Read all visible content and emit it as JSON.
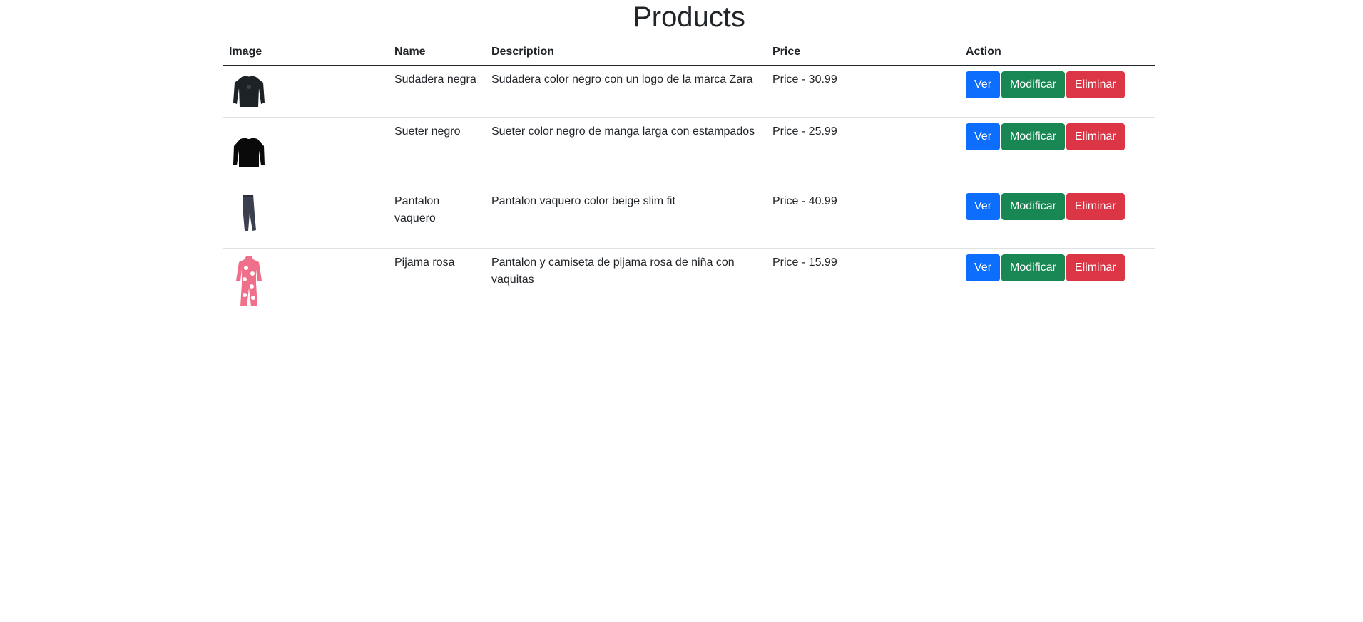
{
  "page": {
    "title": "Products"
  },
  "table": {
    "headers": {
      "image": "Image",
      "name": "Name",
      "description": "Description",
      "price": "Price",
      "action": "Action"
    },
    "rows": [
      {
        "name": "Sudadera negra",
        "description": "Sudadera color negro con un logo de la marca Zara",
        "price": "Price - 30.99",
        "image_icon": "black-sweatshirt-image",
        "actions": {
          "view": "Ver",
          "edit": "Modificar",
          "delete": "Eliminar"
        }
      },
      {
        "name": "Sueter negro",
        "description": "Sueter color negro de manga larga con estampados",
        "price": "Price - 25.99",
        "image_icon": "black-sweater-image",
        "actions": {
          "view": "Ver",
          "edit": "Modificar",
          "delete": "Eliminar"
        }
      },
      {
        "name": "Pantalon vaquero",
        "description": "Pantalon vaquero color beige slim fit",
        "price": "Price - 40.99",
        "image_icon": "jeans-image",
        "actions": {
          "view": "Ver",
          "edit": "Modificar",
          "delete": "Eliminar"
        }
      },
      {
        "name": "Pijama rosa",
        "description": "Pantalon y camiseta de pijama rosa de niña con vaquitas",
        "price": "Price - 15.99",
        "image_icon": "pink-pajama-image",
        "actions": {
          "view": "Ver",
          "edit": "Modificar",
          "delete": "Eliminar"
        }
      }
    ]
  },
  "colors": {
    "view_button": "#0d6efd",
    "edit_button": "#198754",
    "delete_button": "#dc3545",
    "text": "#212529"
  }
}
